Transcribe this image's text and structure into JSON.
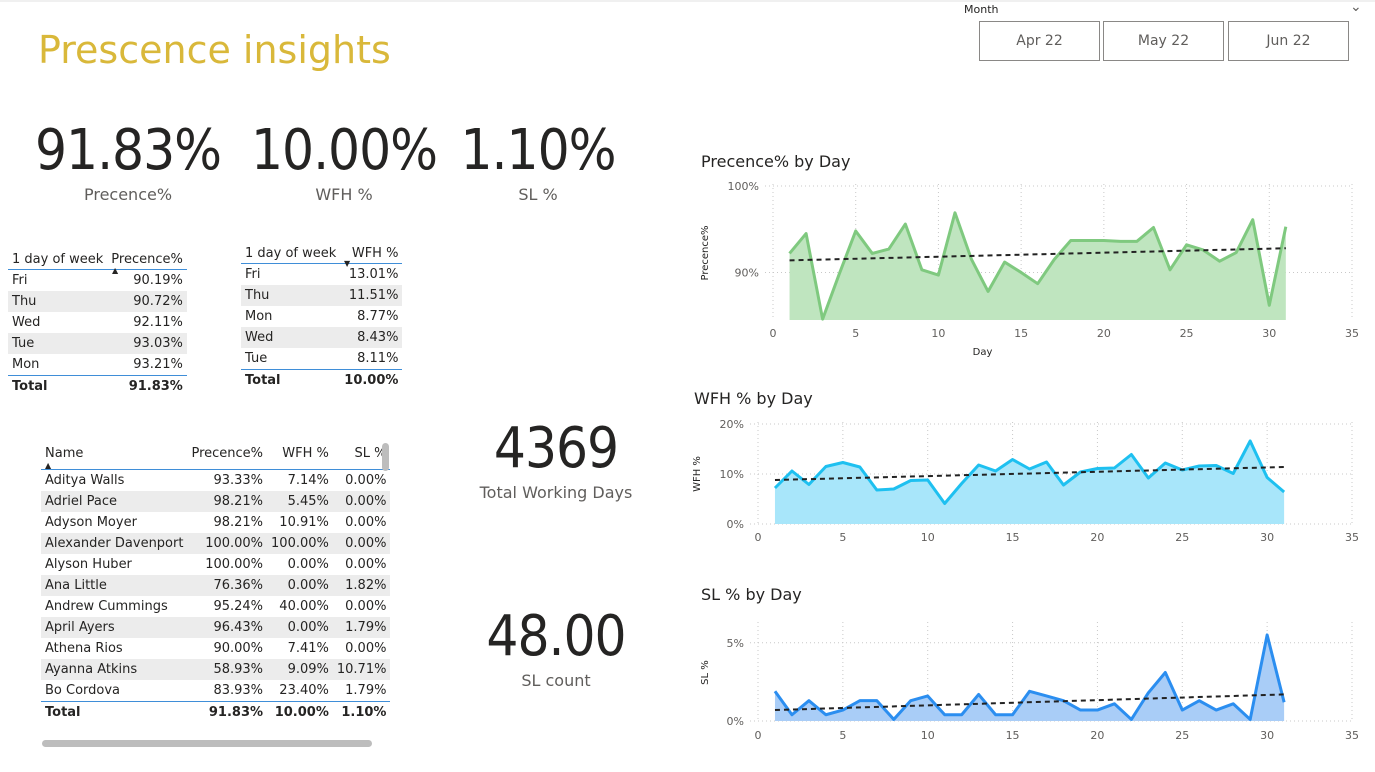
{
  "title": "Prescence insights",
  "slicer": {
    "label": "Month",
    "options": [
      "Apr 22",
      "May 22",
      "Jun 22"
    ]
  },
  "kpis": {
    "presence": {
      "value": "91.83%",
      "label": "Precence%"
    },
    "wfh": {
      "value": "10.00%",
      "label": "WFH %"
    },
    "sl": {
      "value": "1.10%",
      "label": "SL %"
    },
    "working_days": {
      "value": "4369",
      "label": "Total Working Days"
    },
    "sl_count": {
      "value": "48.00",
      "label": "SL count"
    }
  },
  "presence_by_weekday": {
    "headers": [
      "1 day of week",
      "Precence%"
    ],
    "rows": [
      [
        "Fri",
        "90.19%"
      ],
      [
        "Thu",
        "90.72%"
      ],
      [
        "Wed",
        "92.11%"
      ],
      [
        "Tue",
        "93.03%"
      ],
      [
        "Mon",
        "93.21%"
      ]
    ],
    "total": [
      "Total",
      "91.83%"
    ]
  },
  "wfh_by_weekday": {
    "headers": [
      "1 day of week",
      "WFH %"
    ],
    "rows": [
      [
        "Fri",
        "13.01%"
      ],
      [
        "Thu",
        "11.51%"
      ],
      [
        "Mon",
        "8.77%"
      ],
      [
        "Wed",
        "8.43%"
      ],
      [
        "Tue",
        "8.11%"
      ]
    ],
    "total": [
      "Total",
      "10.00%"
    ]
  },
  "people": {
    "headers": [
      "Name",
      "Precence%",
      "WFH %",
      "SL %"
    ],
    "rows": [
      [
        "Aditya Walls",
        "93.33%",
        "7.14%",
        "0.00%"
      ],
      [
        "Adriel Pace",
        "98.21%",
        "5.45%",
        "0.00%"
      ],
      [
        "Adyson Moyer",
        "98.21%",
        "10.91%",
        "0.00%"
      ],
      [
        "Alexander Davenport",
        "100.00%",
        "100.00%",
        "0.00%"
      ],
      [
        "Alyson Huber",
        "100.00%",
        "0.00%",
        "0.00%"
      ],
      [
        "Ana Little",
        "76.36%",
        "0.00%",
        "1.82%"
      ],
      [
        "Andrew Cummings",
        "95.24%",
        "40.00%",
        "0.00%"
      ],
      [
        "April Ayers",
        "96.43%",
        "0.00%",
        "1.79%"
      ],
      [
        "Athena Rios",
        "90.00%",
        "7.41%",
        "0.00%"
      ],
      [
        "Ayanna Atkins",
        "58.93%",
        "9.09%",
        "10.71%"
      ],
      [
        "Bo Cordova",
        "83.93%",
        "23.40%",
        "1.79%"
      ]
    ],
    "total": [
      "Total",
      "91.83%",
      "10.00%",
      "1.10%"
    ]
  },
  "chart_data": [
    {
      "type": "area",
      "title": "Precence% by Day",
      "xlabel": "Day",
      "ylabel": "Precence%",
      "color": "#7fc97f",
      "fill": "#bfe5bf",
      "xlim": [
        0,
        35
      ],
      "ylim": [
        84.5,
        100
      ],
      "xticks": [
        0,
        5,
        10,
        15,
        20,
        25,
        30,
        35
      ],
      "yticks": [
        {
          "v": 90,
          "t": "90%"
        },
        {
          "v": 100,
          "t": "100%"
        }
      ],
      "trend": [
        91.4,
        92.8
      ],
      "x": [
        1,
        2,
        3,
        4,
        5,
        6,
        7,
        8,
        9,
        10,
        11,
        12,
        13,
        14,
        15,
        16,
        17,
        18,
        19,
        20,
        21,
        22,
        23,
        24,
        25,
        26,
        27,
        28,
        29,
        30,
        31
      ],
      "values": [
        92.2,
        94.5,
        84.6,
        89.8,
        94.8,
        92.2,
        92.7,
        95.6,
        90.3,
        89.7,
        96.9,
        91.5,
        87.8,
        91.2,
        90.0,
        88.7,
        91.5,
        93.7,
        93.7,
        93.7,
        93.6,
        93.6,
        95.2,
        90.3,
        93.2,
        92.6,
        91.3,
        92.3,
        96.1,
        86.2,
        95.3
      ]
    },
    {
      "type": "area",
      "title": "WFH % by Day",
      "xlabel": "",
      "ylabel": "WFH %",
      "color": "#1ec0f0",
      "fill": "#a8e6fa",
      "xlim": [
        0,
        35
      ],
      "ylim": [
        0,
        20
      ],
      "xticks": [
        0,
        5,
        10,
        15,
        20,
        25,
        30,
        35
      ],
      "yticks": [
        {
          "v": 0,
          "t": "0%"
        },
        {
          "v": 10,
          "t": "10%"
        },
        {
          "v": 20,
          "t": "20%"
        }
      ],
      "trend": [
        8.8,
        11.4
      ],
      "x": [
        1,
        2,
        3,
        4,
        5,
        6,
        7,
        8,
        9,
        10,
        11,
        12,
        13,
        14,
        15,
        16,
        17,
        18,
        19,
        20,
        21,
        22,
        23,
        24,
        25,
        26,
        27,
        28,
        29,
        30,
        31
      ],
      "values": [
        7.2,
        10.6,
        7.9,
        11.5,
        12.3,
        11.4,
        6.8,
        7.0,
        8.7,
        8.8,
        4.1,
        8.1,
        11.8,
        10.6,
        12.9,
        11.0,
        12.4,
        7.8,
        10.4,
        11.1,
        11.2,
        13.9,
        9.2,
        12.2,
        10.8,
        11.6,
        11.7,
        10.1,
        16.6,
        9.3,
        6.4
      ]
    },
    {
      "type": "area",
      "title": "SL % by Day",
      "xlabel": "",
      "ylabel": "SL %",
      "color": "#2b8ef0",
      "fill": "#a9cdf7",
      "xlim": [
        0,
        35
      ],
      "ylim": [
        0,
        6.2
      ],
      "xticks": [
        0,
        5,
        10,
        15,
        20,
        25,
        30,
        35
      ],
      "yticks": [
        {
          "v": 0,
          "t": "0%"
        },
        {
          "v": 5,
          "t": "5%"
        }
      ],
      "trend": [
        0.7,
        1.7
      ],
      "x": [
        1,
        2,
        3,
        4,
        5,
        6,
        7,
        8,
        9,
        10,
        11,
        12,
        13,
        14,
        15,
        16,
        17,
        18,
        19,
        20,
        21,
        22,
        23,
        24,
        25,
        26,
        27,
        28,
        29,
        30,
        31
      ],
      "values": [
        1.9,
        0.4,
        1.3,
        0.4,
        0.7,
        1.3,
        1.3,
        0.1,
        1.3,
        1.6,
        0.4,
        0.4,
        1.7,
        0.4,
        0.4,
        1.9,
        1.6,
        1.3,
        0.7,
        0.7,
        1.1,
        0.1,
        1.8,
        3.1,
        0.7,
        1.3,
        0.7,
        1.1,
        0.1,
        5.5,
        1.2
      ]
    }
  ]
}
